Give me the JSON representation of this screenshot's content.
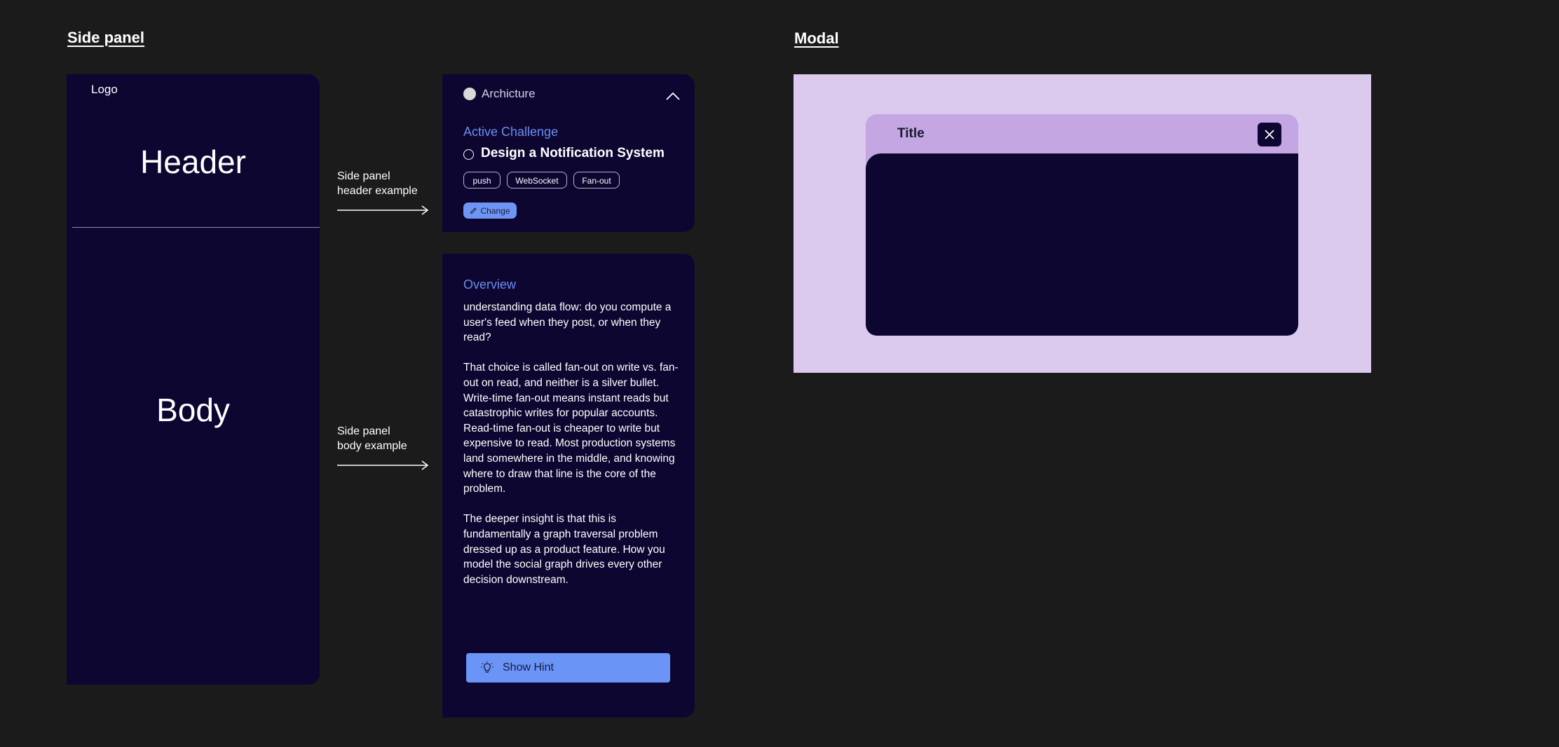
{
  "sections": {
    "side_panel_title": "Side panel",
    "modal_title": "Modal"
  },
  "wireframe": {
    "logo": "Logo",
    "header": "Header",
    "body": "Body"
  },
  "annotations": {
    "header_line1": "Side panel",
    "header_line2": "header example",
    "body_line1": "Side panel",
    "body_line2": "body example"
  },
  "header_example": {
    "category": "Archicture",
    "active_label": "Active Challenge",
    "challenge_title": "Design a Notification System",
    "tags": [
      "push",
      "WebSocket",
      "Fan-out"
    ],
    "change_label": "Change",
    "collapse_icon": "chevron-up-icon"
  },
  "body_example": {
    "overview_label": "Overview",
    "paragraphs": [
      "understanding data flow: do you compute a user's feed when they post, or when they read?",
      "That choice is called fan-out on write vs. fan-out on read, and neither is a silver bullet. Write-time fan-out means instant reads but catastrophic writes for popular accounts. Read-time fan-out is cheaper to write but expensive to read. Most production systems land somewhere in the middle, and knowing where to draw that line is the core of the problem.",
      "The deeper insight is that this is fundamentally a graph traversal problem dressed up as a product feature. How you model the social graph drives every other decision downstream."
    ],
    "hint_label": "Show Hint",
    "hint_icon": "lightbulb-icon"
  },
  "modal": {
    "title": "Title",
    "close_icon": "close-icon"
  },
  "colors": {
    "page_bg": "#1b1b1b",
    "panel_bg": "#0d0630",
    "accent_blue": "#6a8ef0",
    "modal_bg": "#dcc9ee",
    "modal_header": "#c3a6e2"
  }
}
